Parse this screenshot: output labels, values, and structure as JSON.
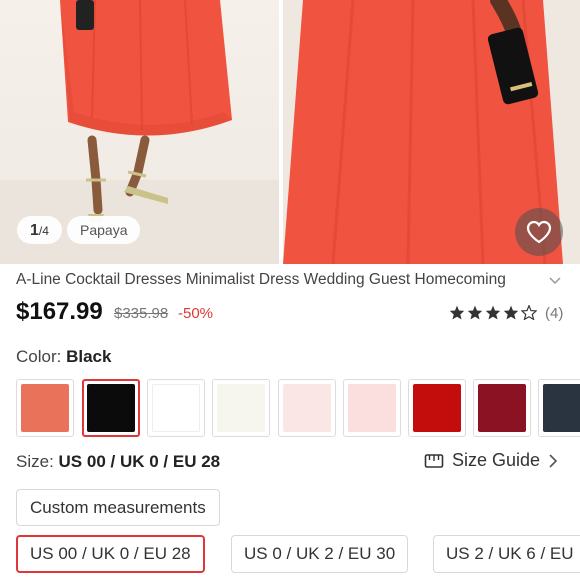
{
  "gallery": {
    "pager_current": "1",
    "pager_total": "/4",
    "variant_chip": "Papaya"
  },
  "product": {
    "title": "A-Line Cocktail Dresses Minimalist Dress Wedding Guest Homecoming",
    "price": "$167.99",
    "old_price": "$335.98",
    "discount": "-50%",
    "rating": 4.5,
    "review_count": "(4)"
  },
  "color": {
    "label": "Color:",
    "selected": "Black",
    "swatches": [
      "#e8735a",
      "#0b0b0b",
      "#ffffff",
      "#f6f6ef",
      "#fbe6e6",
      "#fbdede",
      "#c30d0d",
      "#8a1222",
      "#2a3340"
    ]
  },
  "size": {
    "label": "Size:",
    "selected": "US 00 / UK 0 / EU 28",
    "guide_label": "Size Guide",
    "custom_label": "Custom measurements",
    "options": [
      "US 00 / UK 0 / EU 28",
      "US 0 / UK 2 / EU 30",
      "US 2 / UK 6 / EU"
    ]
  },
  "colors": {
    "accent": "#e0363a",
    "dress": "#f0533f"
  }
}
